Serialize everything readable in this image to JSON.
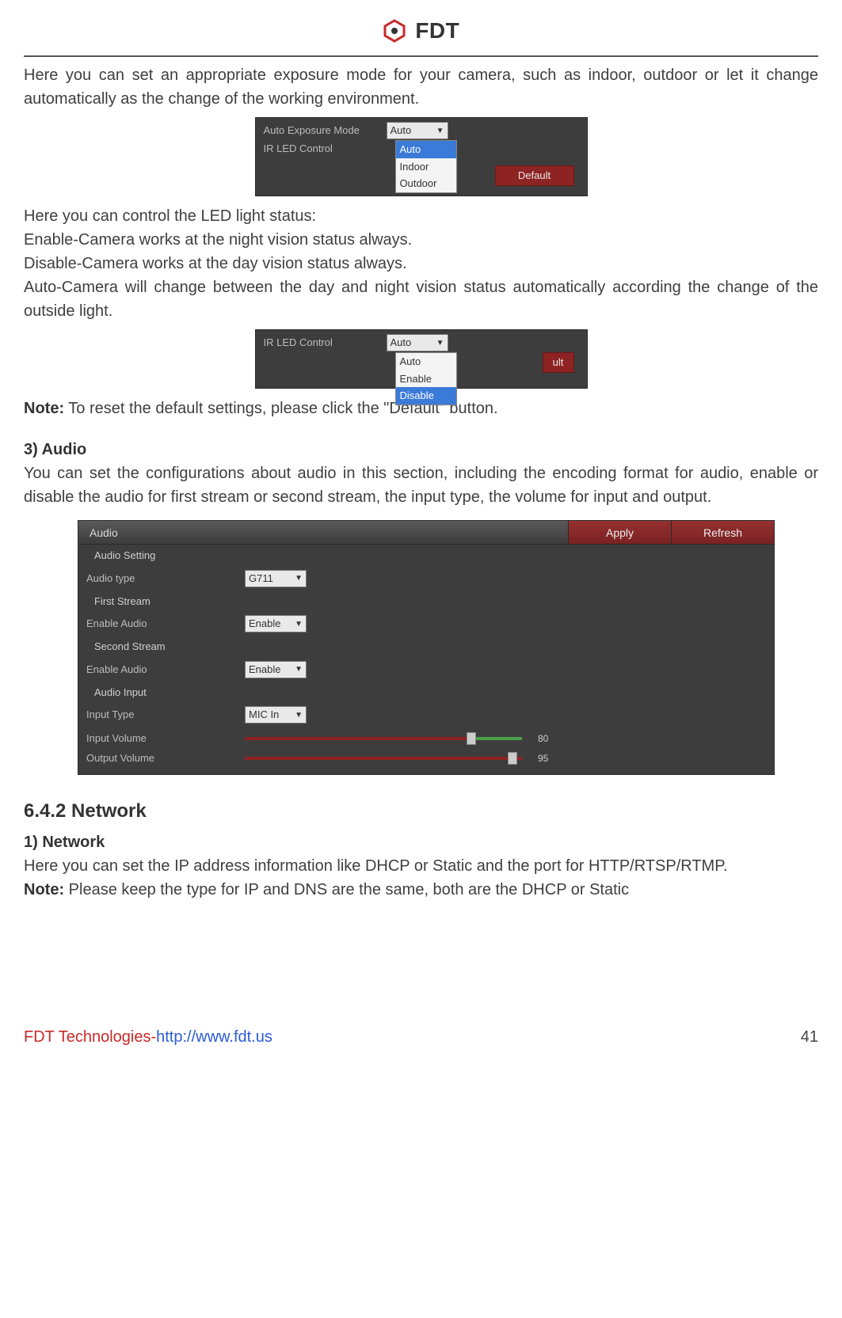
{
  "header": {
    "brand": "FDT"
  },
  "body": {
    "p1": "Here you can set an appropriate exposure mode for your camera, such as indoor, outdoor or let it change automatically as the change of the working environment.",
    "led_intro": "Here you can control the LED light status:",
    "led_enable": "Enable-Camera works at the night vision status always.",
    "led_disable": "Disable-Camera works at the day vision status always.",
    "led_auto": "Auto-Camera will change between the day and night vision status automatically according the change of the outside light.",
    "note_label": "Note:",
    "note_text": " To reset the default settings, please click the \"Default\" button.",
    "audio_head": "3) Audio",
    "audio_desc": "You can set the configurations about audio in this section, including the encoding format for audio, enable or disable the audio for first stream or second stream, the input type, the volume for input and output.",
    "net_h2": "6.4.2 Network",
    "net_h3": "1) Network",
    "net_p": "Here you can set the IP address information like DHCP or Static and the port for HTTP/RTSP/RTMP.",
    "net_note_label": "Note:",
    "net_note_text": " Please keep the type for IP and DNS are the same, both are the DHCP or Static"
  },
  "ui1": {
    "row1_label": "Auto Exposure Mode",
    "row1_value": "Auto",
    "row2_label": "IR LED Control",
    "dropdown": [
      "Auto",
      "Indoor",
      "Outdoor"
    ],
    "selected": "Auto",
    "default_btn": "Default"
  },
  "ui2": {
    "row_label": "IR LED Control",
    "row_value": "Auto",
    "dropdown": [
      "Auto",
      "Enable",
      "Disable"
    ],
    "selected": "Disable",
    "default_btn": "ult"
  },
  "ui3": {
    "title": "Audio",
    "apply": "Apply",
    "refresh": "Refresh",
    "sub_setting": "Audio Setting",
    "audio_type_label": "Audio type",
    "audio_type_value": "G711",
    "sub_first": "First Stream",
    "enable1_label": "Enable Audio",
    "enable1_value": "Enable",
    "sub_second": "Second Stream",
    "enable2_label": "Enable Audio",
    "enable2_value": "Enable",
    "sub_input": "Audio Input",
    "input_type_label": "Input Type",
    "input_type_value": "MIC In",
    "input_vol_label": "Input Volume",
    "input_vol_value": "80",
    "output_vol_label": "Output Volume",
    "output_vol_value": "95"
  },
  "footer": {
    "company": "FDT Technologies-",
    "url": "http://www.fdt.us",
    "page": "41"
  }
}
